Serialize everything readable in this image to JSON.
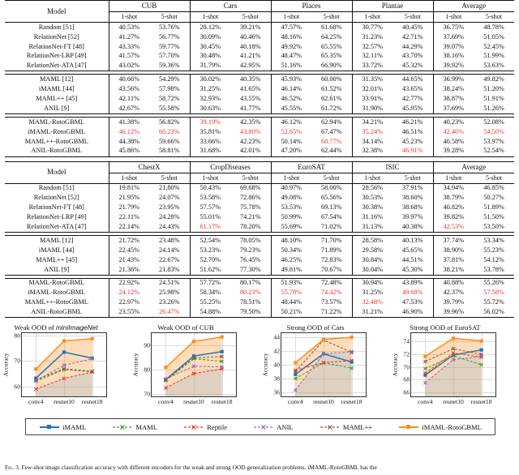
{
  "tables": [
    {
      "id": "table-weak-ood",
      "model_header": "Model",
      "groups": [
        "CUB",
        "Cars",
        "Places",
        "Plantae",
        "Average"
      ],
      "subheaders": [
        "1-shot",
        "5-shot"
      ],
      "sections": [
        {
          "rows": [
            {
              "model": "Random [51]",
              "bold": false,
              "values": [
                "40.53%",
                "53.76%",
                "28.12%",
                "39.21%",
                "47.57%",
                "61.68%",
                "30.77%",
                "40.45%",
                "36.75%",
                "48.78%"
              ],
              "red": []
            },
            {
              "model": "RelationNet [52]",
              "bold": false,
              "values": [
                "41.27%",
                "56.77%",
                "30.09%",
                "40.46%",
                "48.16%",
                "64.25%",
                "31.23%",
                "42.71%",
                "37.69%",
                "51.05%"
              ],
              "red": []
            },
            {
              "model": "RelationNet-FT [48]",
              "bold": false,
              "values": [
                "43.33%",
                "59.77%",
                "30.45%",
                "40.18%",
                "49.92%",
                "65.55%",
                "32.57%",
                "44.29%",
                "39.07%",
                "52.45%"
              ],
              "red": []
            },
            {
              "model": "RelationNet-LRP [49]",
              "bold": false,
              "values": [
                "41.57%",
                "57.70%",
                "30.48%",
                "41.21%",
                "48.47%",
                "65.35%",
                "32.11%",
                "43.70%",
                "38.16%",
                "51.99%"
              ],
              "red": []
            },
            {
              "model": "RelationNet-ATA [47]",
              "bold": false,
              "values": [
                "43.02%",
                "59.36%",
                "31.79%",
                "42.95%",
                "51.16%",
                "66.90%",
                "33.72%",
                "45.32%",
                "39.92%",
                "53.63%"
              ],
              "red": []
            }
          ]
        },
        {
          "rows": [
            {
              "model": "MAML [12]",
              "bold": false,
              "values": [
                "40.66%",
                "54.29%",
                "30.02%",
                "40.35%",
                "45.93%",
                "60.00%",
                "31.35%",
                "44.65%",
                "36.99%",
                "49.82%"
              ],
              "red": []
            },
            {
              "model": "iMAML [44]",
              "bold": false,
              "values": [
                "43.56%",
                "57.98%",
                "31.25%",
                "41.65%",
                "46.14%",
                "61.52%",
                "32.01%",
                "43.65%",
                "38.24%",
                "51.20%"
              ],
              "red": []
            },
            {
              "model": "MAML++ [45]",
              "bold": false,
              "values": [
                "42.11%",
                "58.72%",
                "32.93%",
                "43.55%",
                "46.52%",
                "62.61%",
                "33.91%",
                "42.77%",
                "38.87%",
                "51.91%"
              ],
              "red": []
            },
            {
              "model": "ANIL [9]",
              "bold": false,
              "values": [
                "42.67%",
                "55.58%",
                "30.63%",
                "41.77%",
                "45.55%",
                "61.72%",
                "31.90%",
                "45.95%",
                "37.69%",
                "51.26%"
              ],
              "red": []
            }
          ]
        },
        {
          "rows": [
            {
              "model": "MAML-RotoGBML",
              "bold": true,
              "values": [
                "41.38%",
                "56.82%",
                "39.19%",
                "42.35%",
                "46.12%",
                "62.94%",
                "34.21%",
                "46.21%",
                "40.23%",
                "52.08%"
              ],
              "red": [
                2
              ]
            },
            {
              "model": "iMAML-RotoGBML",
              "bold": true,
              "values": [
                "46.12%",
                "60.23%",
                "35.81%",
                "43.80%",
                "52.65%",
                "67.47%",
                "35.24%",
                "46.51%",
                "42.46%",
                "54.50%"
              ],
              "red": [
                0,
                1,
                3,
                4,
                6,
                8,
                9
              ]
            },
            {
              "model": "MAML++-RotoGBML",
              "bold": true,
              "values": [
                "44.38%",
                "59.66%",
                "33.66%",
                "42.23%",
                "50.14%",
                "68.77%",
                "34.14%",
                "45.23%",
                "40.58%",
                "53.97%"
              ],
              "red": [
                5
              ]
            },
            {
              "model": "ANIL-RotoGBML",
              "bold": true,
              "values": [
                "45.86%",
                "58.81%",
                "31.68%",
                "42.01%",
                "47.20%",
                "62.44%",
                "32.38%",
                "46.91%",
                "39.28%",
                "52.54%"
              ],
              "red": [
                7
              ]
            }
          ]
        }
      ]
    },
    {
      "id": "table-strong-ood",
      "model_header": "Model",
      "groups": [
        "ChestX",
        "CropDiseases",
        "EuroSAT",
        "ISIC",
        "Average"
      ],
      "subheaders": [
        "1-shot",
        "5-shot"
      ],
      "sections": [
        {
          "rows": [
            {
              "model": "Random [51]",
              "bold": false,
              "values": [
                "19.81%",
                "21.80%",
                "50.43%",
                "69.68%",
                "40.97%",
                "58.00%",
                "28.56%",
                "37.91%",
                "34.94%",
                "46.85%"
              ],
              "red": []
            },
            {
              "model": "RelationNet [52]",
              "bold": false,
              "values": [
                "21.95%",
                "24.07%",
                "53.58%",
                "72.86%",
                "49.08%",
                "65.56%",
                "30.53%",
                "38.60%",
                "38.79%",
                "50.27%"
              ],
              "red": []
            },
            {
              "model": "RelationNet-FT [48]",
              "bold": false,
              "values": [
                "21.79%",
                "23.95%",
                "57.57%",
                "75.78%",
                "53.53%",
                "69.13%",
                "30.38%",
                "38.68%",
                "40.82%",
                "51.89%"
              ],
              "red": []
            },
            {
              "model": "RelationNet-LRP [49]",
              "bold": false,
              "values": [
                "22.11%",
                "24.28%",
                "55.01%",
                "74.21%",
                "50.99%",
                "67.54%",
                "31.16%",
                "39.97%",
                "39.82%",
                "51.50%"
              ],
              "red": []
            },
            {
              "model": "RelationNet-ATA [47]",
              "bold": false,
              "values": [
                "22.14%",
                "24.43%",
                "61.17%",
                "78.20%",
                "55.69%",
                "71.02%",
                "31.13%",
                "40.38%",
                "42.53%",
                "53.50%"
              ],
              "red": [
                2,
                8
              ]
            }
          ]
        },
        {
          "rows": [
            {
              "model": "MAML [12]",
              "bold": false,
              "values": [
                "21.72%",
                "23.48%",
                "52.54%",
                "78.05%",
                "48.10%",
                "71.70%",
                "28.58%",
                "40.13%",
                "37.74%",
                "53.34%"
              ],
              "red": []
            },
            {
              "model": "iMAML [44]",
              "bold": false,
              "values": [
                "22.45%",
                "24.14%",
                "53.23%",
                "79.23%",
                "50.34%",
                "71.89%",
                "29.58%",
                "45.65%",
                "38.90%",
                "55.23%"
              ],
              "red": []
            },
            {
              "model": "MAML++ [45]",
              "bold": false,
              "values": [
                "21.43%",
                "22.67%",
                "52.70%",
                "76.45%",
                "46.25%",
                "72.83%",
                "30.84%",
                "44.51%",
                "37.81%",
                "54.12%"
              ],
              "red": []
            },
            {
              "model": "ANIL [9]",
              "bold": false,
              "values": [
                "21.36%",
                "21.83%",
                "51.62%",
                "77.30%",
                "49.81%",
                "70.67%",
                "30.04%",
                "45.30%",
                "38.21%",
                "53.78%"
              ],
              "red": []
            }
          ]
        },
        {
          "rows": [
            {
              "model": "MAML-RotoGBML",
              "bold": true,
              "values": [
                "22.92%",
                "24.51%",
                "57.72%",
                "80.17%",
                "51.93%",
                "72.48%",
                "30.94%",
                "43.89%",
                "40.88%",
                "55.26%"
              ],
              "red": []
            },
            {
              "model": "iMAML-RotoGBML",
              "bold": true,
              "values": [
                "24.12%",
                "25.98%",
                "58.34%",
                "80.23%",
                "55.78%",
                "74.42%",
                "31.25%",
                "49.68%",
                "42.37%",
                "57.58%"
              ],
              "red": [
                0,
                3,
                4,
                5,
                7,
                9
              ]
            },
            {
              "model": "MAML++-RotoGBML",
              "bold": true,
              "values": [
                "22.97%",
                "23.26%",
                "55.25%",
                "78.51%",
                "48.44%",
                "73.57%",
                "32.48%",
                "47.53%",
                "39.79%",
                "55.72%"
              ],
              "red": [
                6
              ]
            },
            {
              "model": "ANIL-RotoGBML",
              "bold": true,
              "values": [
                "23.55%",
                "26.47%",
                "54.88%",
                "79.50%",
                "50.21%",
                "71.22%",
                "31.21%",
                "46.90%",
                "39.96%",
                "56.02%"
              ],
              "red": [
                1
              ]
            }
          ]
        }
      ]
    }
  ],
  "figure": {
    "legend": [
      {
        "label": "iMAML",
        "color": "#1f77b4",
        "style": "solid",
        "marker": "square"
      },
      {
        "label": "MAML",
        "color": "#2ca02c",
        "style": "dashed",
        "marker": "x"
      },
      {
        "label": "Reptile",
        "color": "#e8362a",
        "style": "dashed",
        "marker": "x"
      },
      {
        "label": "ANIL",
        "color": "#9467bd",
        "style": "dashed",
        "marker": "x"
      },
      {
        "label": "MAML++",
        "color": "#8c564b",
        "style": "dashed",
        "marker": "x"
      },
      {
        "label": "iMAML-RotoGBML",
        "color": "#ff8c1a",
        "style": "solid",
        "marker": "square"
      }
    ],
    "caption_prefix": "Fig. 3.",
    "caption": "Few-shot image classification accuracy with different encoders for the weak and strong OOD generalization problems. iMAML-RotoGBML has the"
  },
  "chart_data": [
    {
      "type": "line",
      "title": "Weak OOD of miniImageNet",
      "title_plain": "Weak OOD of ",
      "title_italic": "miniImageNet",
      "xlabel": "",
      "ylabel": "Accuracy",
      "categories": [
        "conv4",
        "resnet10",
        "resnet18"
      ],
      "ylim": [
        56,
        81
      ],
      "yticks": [
        60,
        70,
        80
      ],
      "grid": true,
      "fill_between": [
        "Reptile",
        "iMAML-RotoGBML"
      ],
      "series": [
        {
          "name": "iMAML",
          "values": [
            63.2,
            73.5,
            71.1
          ]
        },
        {
          "name": "MAML",
          "values": [
            62.0,
            66.6,
            65.7
          ]
        },
        {
          "name": "Reptile",
          "values": [
            58.9,
            63.1,
            65.6
          ]
        },
        {
          "name": "ANIL",
          "values": [
            62.2,
            68.3,
            70.9
          ]
        },
        {
          "name": "MAML++",
          "values": [
            62.6,
            66.9,
            65.9
          ]
        },
        {
          "name": "iMAML-RotoGBML",
          "values": [
            66.8,
            77.9,
            78.8
          ]
        }
      ]
    },
    {
      "type": "line",
      "title": "Weak OOD of CUB",
      "title_plain": "Weak OOD of CUB",
      "title_italic": "",
      "xlabel": "",
      "ylabel": "Accuracy",
      "categories": [
        "conv4",
        "resnet10",
        "resnet18"
      ],
      "ylim": [
        69,
        95
      ],
      "yticks": [
        70,
        80,
        90
      ],
      "grid": true,
      "fill_between": [
        "Reptile",
        "iMAML-RotoGBML"
      ],
      "series": [
        {
          "name": "iMAML",
          "values": [
            75.9,
            85.6,
            87.4
          ]
        },
        {
          "name": "MAML",
          "values": [
            75.5,
            84.5,
            83.4
          ]
        },
        {
          "name": "Reptile",
          "values": [
            72.5,
            78.4,
            80.3
          ]
        },
        {
          "name": "ANIL",
          "values": [
            76.1,
            81.4,
            81.1
          ]
        },
        {
          "name": "MAML++",
          "values": [
            75.8,
            84.8,
            85.4
          ]
        },
        {
          "name": "iMAML-RotoGBML",
          "values": [
            80.9,
            91.6,
            93.4
          ]
        }
      ]
    },
    {
      "type": "line",
      "title": "Strong OOD of Cars",
      "title_plain": "Strong OOD of Cars",
      "title_italic": "",
      "xlabel": "",
      "ylabel": "Accuracy",
      "categories": [
        "conv4",
        "resnet10",
        "resnet18"
      ],
      "ylim": [
        35.4,
        44.6
      ],
      "yticks": [
        36,
        38,
        40,
        42,
        44
      ],
      "grid": true,
      "fill_between": [
        "ANIL",
        "iMAML-RotoGBML"
      ],
      "series": [
        {
          "name": "iMAML",
          "values": [
            38.6,
            41.6,
            40.4
          ]
        },
        {
          "name": "MAML",
          "values": [
            38.0,
            40.3,
            39.5
          ]
        },
        {
          "name": "Reptile",
          "values": [
            39.2,
            40.3,
            40.6
          ]
        },
        {
          "name": "ANIL",
          "values": [
            36.3,
            41.6,
            41.9
          ]
        },
        {
          "name": "MAML++",
          "values": [
            39.0,
            43.6,
            41.8
          ]
        },
        {
          "name": "iMAML-RotoGBML",
          "values": [
            40.3,
            43.7,
            44.0
          ]
        }
      ]
    },
    {
      "type": "line",
      "title": "Strong OOD of EuroSAT",
      "title_plain": "Strong OOD of EuroSAT",
      "title_italic": "",
      "xlabel": "",
      "ylabel": "Accuracy",
      "categories": [
        "conv4",
        "resnet10",
        "resnet18"
      ],
      "ylim": [
        65.4,
        75.2
      ],
      "yticks": [
        66,
        68,
        70,
        72,
        74
      ],
      "grid": true,
      "fill_between": [
        "ANIL",
        "iMAML-RotoGBML"
      ],
      "series": [
        {
          "name": "iMAML",
          "values": [
            68.7,
            71.8,
            72.6
          ]
        },
        {
          "name": "MAML",
          "values": [
            69.7,
            71.7,
            70.3
          ]
        },
        {
          "name": "Reptile",
          "values": [
            69.0,
            72.1,
            71.5
          ]
        },
        {
          "name": "ANIL",
          "values": [
            67.5,
            71.1,
            71.6
          ]
        },
        {
          "name": "MAML++",
          "values": [
            70.8,
            72.8,
            71.9
          ]
        },
        {
          "name": "iMAML-RotoGBML",
          "values": [
            71.6,
            74.4,
            74.0
          ]
        }
      ]
    }
  ]
}
